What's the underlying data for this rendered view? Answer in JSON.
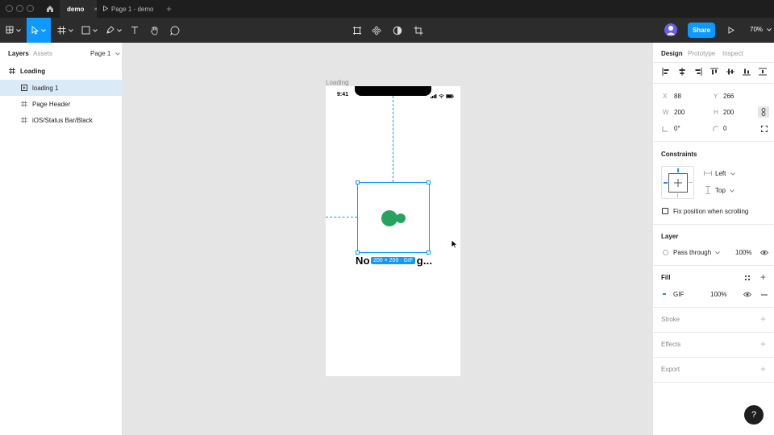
{
  "titlebar": {
    "tabs": [
      {
        "label": "demo",
        "active": true
      },
      {
        "label": "Page 1 - demo",
        "active": false
      }
    ]
  },
  "toolbar": {
    "share_label": "Share",
    "zoom": "70%"
  },
  "left_panel": {
    "tab_layers": "Layers",
    "tab_assets": "Assets",
    "page_select": "Page 1",
    "layers": [
      {
        "label": "Loading",
        "type": "frame"
      },
      {
        "label": "loading 1",
        "type": "image"
      },
      {
        "label": "Page Header",
        "type": "frame"
      },
      {
        "label": "iOS/Status Bar/Black",
        "type": "frame"
      }
    ]
  },
  "canvas": {
    "frame_label": "Loading",
    "status_time": "9:41",
    "frame_text": "No",
    "frame_text_tail": "g...",
    "size_badge": "200 × 200 · GIF",
    "accent_color": "#0d99ff",
    "blob_color": "#27a35f"
  },
  "right_panel": {
    "tab_design": "Design",
    "tab_prototype": "Prototype",
    "tab_inspect": "Inspect",
    "x_label": "X",
    "x_value": "88",
    "y_label": "Y",
    "y_value": "266",
    "w_label": "W",
    "w_value": "200",
    "h_label": "H",
    "h_value": "200",
    "rotation_value": "0°",
    "radius_value": "0",
    "constraints_title": "Constraints",
    "constraint_h": "Left",
    "constraint_v": "Top",
    "fix_position_label": "Fix position when scrolling",
    "layer_title": "Layer",
    "blend_mode": "Pass through",
    "layer_opacity": "100%",
    "fill_title": "Fill",
    "fill_type": "GIF",
    "fill_opacity": "100%",
    "stroke_title": "Stroke",
    "effects_title": "Effects",
    "export_title": "Export"
  },
  "help_label": "?"
}
